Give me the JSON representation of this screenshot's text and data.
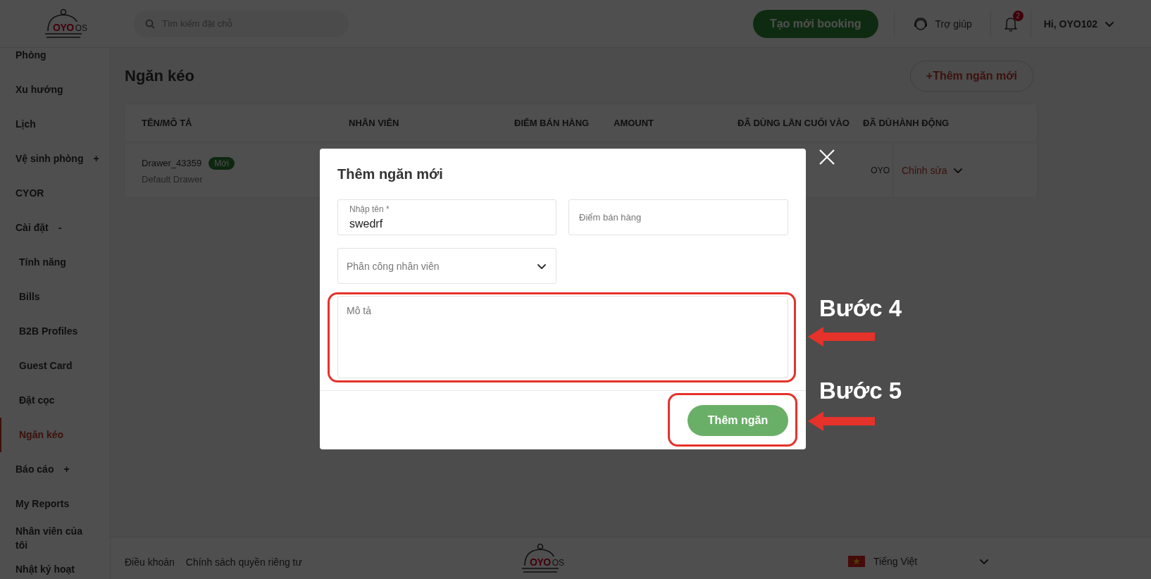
{
  "header": {
    "logo": {
      "brand": "OYO",
      "suffix": "OS"
    },
    "search": {
      "placeholder": "Tìm kiếm đặt chỗ"
    },
    "create_button": "Tạo mới booking",
    "help": "Trợ giúp",
    "notifications": {
      "count": "2"
    },
    "user": "Hi, OYO102"
  },
  "sidebar": {
    "items": [
      {
        "label": "Phòng",
        "selected": false
      },
      {
        "label": "Xu hướng",
        "selected": false
      },
      {
        "label": "Lịch",
        "selected": false
      },
      {
        "label": "Vệ sinh phòng",
        "toggle": "+",
        "selected": false
      },
      {
        "label": "CYOR",
        "selected": false
      },
      {
        "label": "Cài đặt",
        "toggle": "-",
        "selected": false,
        "children": [
          {
            "label": "Tính năng",
            "selected": false
          },
          {
            "label": "Bills",
            "selected": false
          },
          {
            "label": "B2B Profiles",
            "selected": false
          },
          {
            "label": "Guest Card",
            "selected": false
          },
          {
            "label": "Đặt cọc",
            "selected": false
          },
          {
            "label": "Ngăn kéo",
            "selected": true
          }
        ]
      },
      {
        "label": "Báo cáo",
        "toggle": "+",
        "selected": false
      },
      {
        "label": "My Reports",
        "selected": false
      },
      {
        "label": "Nhân viên của tôi",
        "selected": false
      },
      {
        "label": "Nhật ký hoạt",
        "selected": false
      }
    ]
  },
  "page": {
    "title": "Ngăn kéo",
    "add_button": "+Thêm ngăn mới"
  },
  "table": {
    "columns": [
      "TÊN/MÔ TẢ",
      "NHÂN VIÊN",
      "ĐIỂM BÁN HÀNG",
      "AMOUNT",
      "ĐÃ DÙNG LẦN CUỐI VÀO",
      "ĐÃ DÙ",
      "HÀNH ĐỘNG"
    ],
    "rows": [
      {
        "name": "Drawer_43359",
        "badge": "Mới",
        "description": "Default Drawer",
        "column_6": "OYO",
        "action": "Chỉnh sửa"
      }
    ]
  },
  "modal": {
    "title": "Thêm ngăn mới",
    "fields": [
      {
        "kind": "text",
        "label": "Nhập tên *",
        "value": "swedrf"
      },
      {
        "kind": "text",
        "placeholder": "Điểm bán hàng"
      },
      {
        "kind": "select",
        "placeholder": "Phân công nhân viên"
      },
      {
        "kind": "textarea",
        "placeholder": "Mô tả"
      }
    ],
    "submit": "Thêm ngăn"
  },
  "annotations": [
    {
      "label": "Bước 4"
    },
    {
      "label": "Bước 5"
    }
  ],
  "footer": {
    "links": [
      "Điều khoản",
      "Chính sách quyền riêng tư"
    ],
    "logo": {
      "brand": "OYO",
      "suffix": "OS"
    },
    "language": "Tiếng Việt"
  }
}
